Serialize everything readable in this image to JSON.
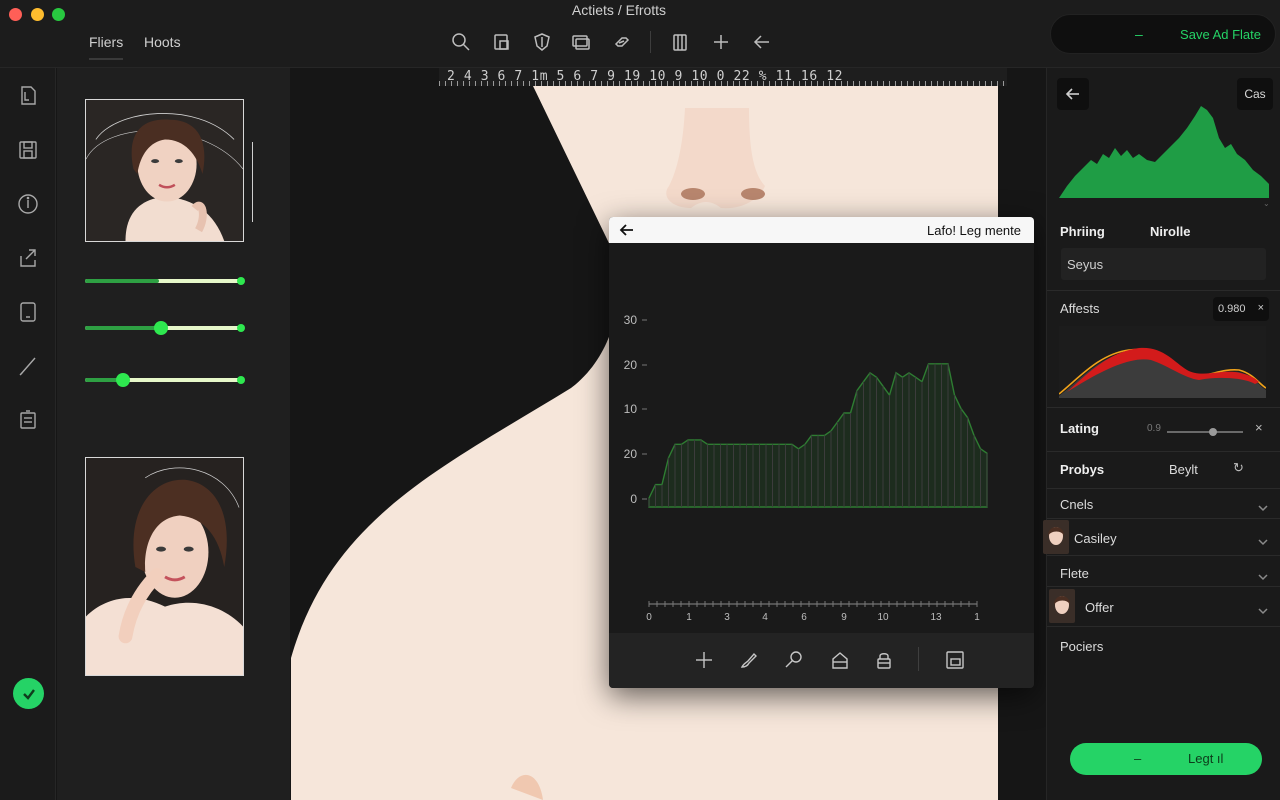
{
  "app": {
    "window_title": "Actiets / Efrotts",
    "tabs": [
      "Fliers",
      "Hoots"
    ],
    "save_button_dash": "–",
    "save_button_label": "Save Ad Flate"
  },
  "toolbar": {
    "icons": [
      "search-icon",
      "layer-icon",
      "shield-icon",
      "stack-icon",
      "link-icon",
      "clipboard-icon",
      "plus-icon",
      "arrow-left-icon"
    ]
  },
  "rail": {
    "icons": [
      "document-icon",
      "save-icon",
      "info-icon",
      "export-icon",
      "tablet-icon",
      "pen-icon",
      "list-icon"
    ],
    "confirm_icon": "check-icon"
  },
  "filters": {
    "sliders": [
      {
        "value": 0.47
      },
      {
        "value": 0.48
      },
      {
        "value": 0.24
      }
    ]
  },
  "canvas": {
    "ruler_label": "2  4  3  6  7  1m  5  6  7  9  19  10  9  10  0  22 %  11  16  12"
  },
  "dialog": {
    "title": "Lafo! Leg mente",
    "chart_data": {
      "type": "area",
      "y_tick_labels": [
        "30",
        "20",
        "10",
        "20",
        "0"
      ],
      "x_tick_labels": [
        "0",
        "1",
        "3",
        "4",
        "6",
        "9",
        "10",
        "13",
        "1"
      ],
      "values": [
        2,
        5,
        5,
        11,
        14,
        14,
        15,
        15,
        15,
        14,
        14,
        14,
        14,
        14,
        14,
        14,
        14,
        14,
        14,
        14,
        14,
        14,
        14,
        13,
        14,
        16,
        16,
        16,
        17,
        19,
        21,
        21,
        26,
        28,
        30,
        29,
        27,
        25,
        30,
        29,
        30,
        29,
        28,
        32,
        32,
        32,
        32,
        25,
        22,
        20,
        16,
        13,
        12
      ],
      "color": "#2e7d32"
    },
    "footer_icons": [
      "plus-icon",
      "brush-icon",
      "magnifier-icon",
      "home-icon",
      "lock-icon",
      "frame-icon"
    ]
  },
  "right_panel": {
    "chip": "Cas",
    "tab_left": "Phriing",
    "tab_right": "Nirolle",
    "input_value": "Seyus",
    "affects_label": "Affests",
    "affects_value": "0.980",
    "affects_close": "×",
    "latings_label": "Lating",
    "latings_value": "0.9",
    "latings_close": "×",
    "probys_label": "Probys",
    "probys_action": "Beylt",
    "rows": [
      "Cnels",
      "Casiley",
      "Flete",
      "Offer",
      "Pociers"
    ],
    "cta_dash": "–",
    "cta_label": "Legt ıl",
    "colors": {
      "accent": "#25d366",
      "histogram": "#1f9d45",
      "curve_red": "#d31b1b",
      "curve_orange": "#f0a21a"
    }
  }
}
